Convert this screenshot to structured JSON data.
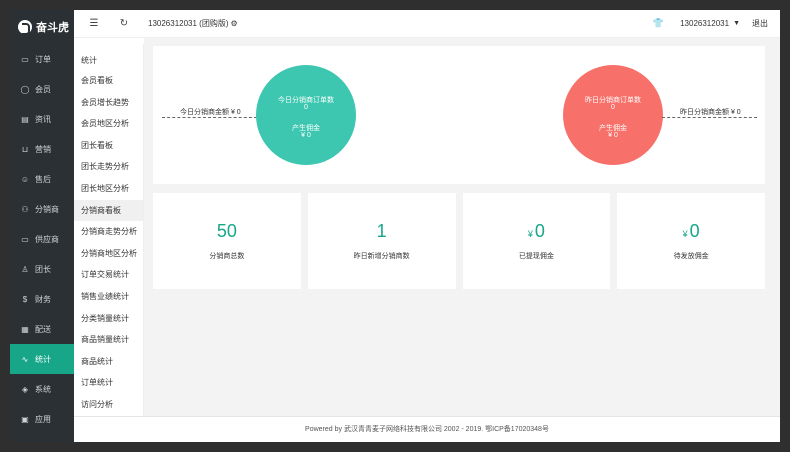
{
  "brand": {
    "name": "奋斗虎"
  },
  "nav": [
    {
      "label": "订单",
      "icon": "cart-icon"
    },
    {
      "label": "会员",
      "icon": "user-icon"
    },
    {
      "label": "资讯",
      "icon": "news-icon"
    },
    {
      "label": "营销",
      "icon": "shopping-cart-icon"
    },
    {
      "label": "售后",
      "icon": "smile-icon"
    },
    {
      "label": "分销商",
      "icon": "users-icon"
    },
    {
      "label": "供应商",
      "icon": "cart-icon"
    },
    {
      "label": "团长",
      "icon": "person-icon"
    },
    {
      "label": "财务",
      "icon": "money-icon"
    },
    {
      "label": "配送",
      "icon": "calendar-icon"
    },
    {
      "label": "统计",
      "icon": "pulse-icon",
      "active": true
    },
    {
      "label": "系统",
      "icon": "shield-icon"
    },
    {
      "label": "应用",
      "icon": "app-icon"
    }
  ],
  "submenu": {
    "title": "统计",
    "items": [
      "会员看板",
      "会员增长趋势",
      "会员地区分析",
      "团长看板",
      "团长走势分析",
      "团长地区分析",
      "分销商看板",
      "分销商走势分析",
      "分销商地区分析",
      "订单交易统计",
      "销售业绩统计",
      "分类销量统计",
      "商品销量统计",
      "商品统计",
      "订单统计",
      "访问分析"
    ],
    "active_index": 6
  },
  "header": {
    "shop_name": "13026312031 (团购版)",
    "username": "13026312031",
    "logout": "退出"
  },
  "summary": {
    "today": {
      "orders_label": "今日分销商订单数",
      "orders_value": "0",
      "commission_label": "产生佣金",
      "commission_value": "¥ 0",
      "amount_label": "今日分销商金额 ¥ 0"
    },
    "yesterday": {
      "orders_label": "昨日分销商订单数",
      "orders_value": "0",
      "commission_label": "产生佣金",
      "commission_value": "¥ 0",
      "amount_label": "昨日分销商金额 ¥ 0"
    }
  },
  "cards": [
    {
      "currency": "",
      "value": "50",
      "label": "分销商总数"
    },
    {
      "currency": "",
      "value": "1",
      "label": "昨日新增分销商数"
    },
    {
      "currency": "¥",
      "value": "0",
      "label": "已提现佣金"
    },
    {
      "currency": "¥",
      "value": "0",
      "label": "待发放佣金"
    }
  ],
  "footer": {
    "text": "Powered by 武汉青青麦子网络科技有限公司 2002 - 2019. 鄂ICP备17020348号"
  },
  "colors": {
    "accent": "#18a689",
    "today_circle": "#3dc7b0",
    "yesterday_circle": "#f8706a",
    "sidebar": "#2a3033"
  }
}
